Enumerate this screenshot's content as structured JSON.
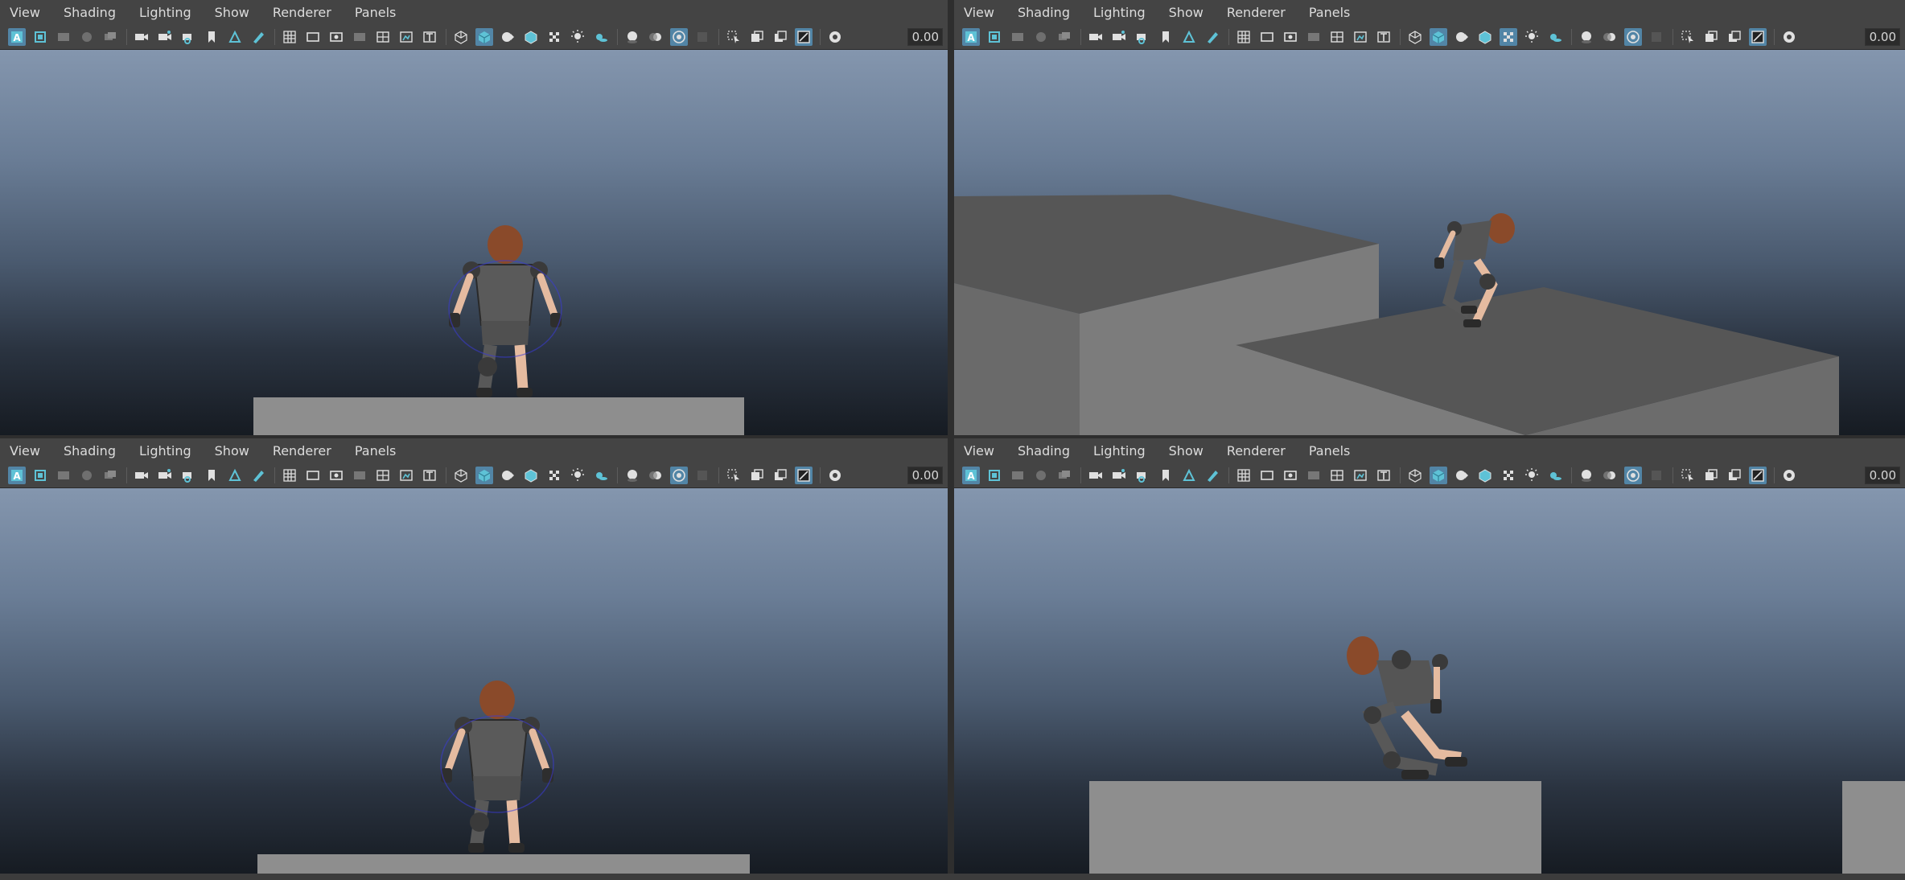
{
  "menus": [
    "View",
    "Shading",
    "Lighting",
    "Show",
    "Renderer",
    "Panels"
  ],
  "time_value": "0.00",
  "accent_color": "#5285a6",
  "viewports": [
    {
      "name": "top-left",
      "view": "front"
    },
    {
      "name": "top-right",
      "view": "perspective"
    },
    {
      "name": "bottom-left",
      "view": "front-alt"
    },
    {
      "name": "bottom-right",
      "view": "side"
    }
  ],
  "toolbar_icons": [
    "select-camera-icon",
    "camera-attributes-icon",
    "bookmarks-icon",
    "image-plane-icon",
    "grid-2d-icon",
    "camera-icon",
    "camera-lock-icon",
    "camera-pan-icon",
    "bookmark-icon",
    "two-d-pan-icon",
    "grease-pencil-icon",
    "grid-icon",
    "film-gate-icon",
    "resolution-gate-icon",
    "gate-mask-icon",
    "field-chart-icon",
    "safe-action-icon",
    "safe-title-icon",
    "wireframe-icon",
    "smooth-shade-icon",
    "shade-selected-icon",
    "wireframe-on-shaded-icon",
    "textured-icon",
    "use-lights-icon",
    "shadows-icon",
    "screen-space-ao-icon",
    "motion-blur-icon",
    "multisample-aa-icon",
    "depth-of-field-icon",
    "isolate-select-icon",
    "xray-icon",
    "xray-joints-icon",
    "xray-active-icon",
    "gamma-icon"
  ]
}
